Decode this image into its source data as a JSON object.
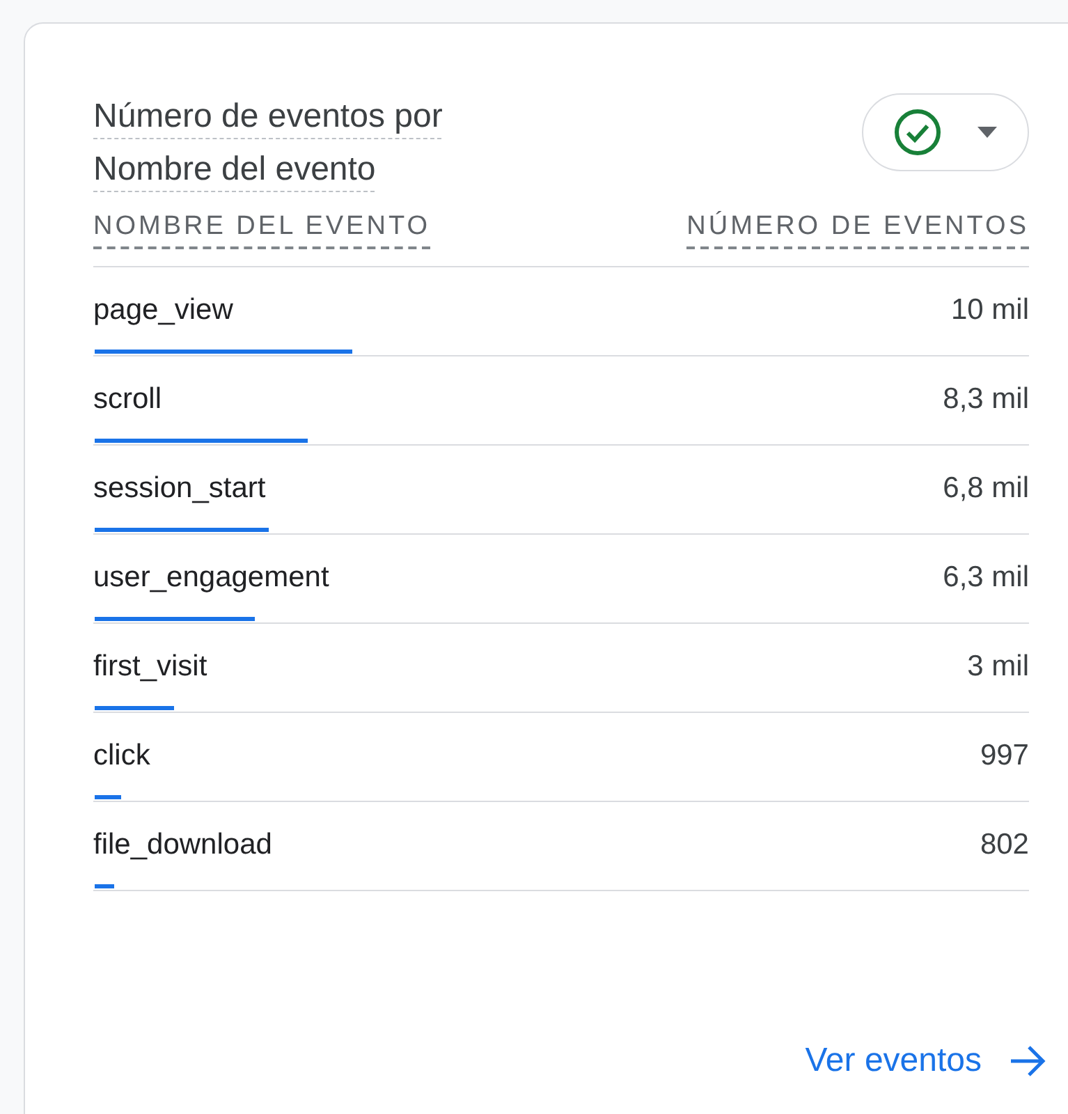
{
  "card": {
    "title": "Número de eventos por Nombre del evento",
    "status_button": {
      "expanded": false
    },
    "columns": [
      "NOMBRE DEL EVENTO",
      "NÚMERO DE EVENTOS"
    ],
    "rows": [
      {
        "name": "page_view",
        "value": "10 mil",
        "level": 0.275
      },
      {
        "name": "scroll",
        "value": "8,3 mil",
        "level": 0.228
      },
      {
        "name": "session_start",
        "value": "6,8 mil",
        "level": 0.186
      },
      {
        "name": "user_engagement",
        "value": "6,3 mil",
        "level": 0.171
      },
      {
        "name": "first_visit",
        "value": "3 mil",
        "level": 0.085
      },
      {
        "name": "click",
        "value": "997",
        "level": 0.028
      },
      {
        "name": "file_download",
        "value": "802",
        "level": 0.021
      }
    ],
    "link": "Ver eventos"
  }
}
